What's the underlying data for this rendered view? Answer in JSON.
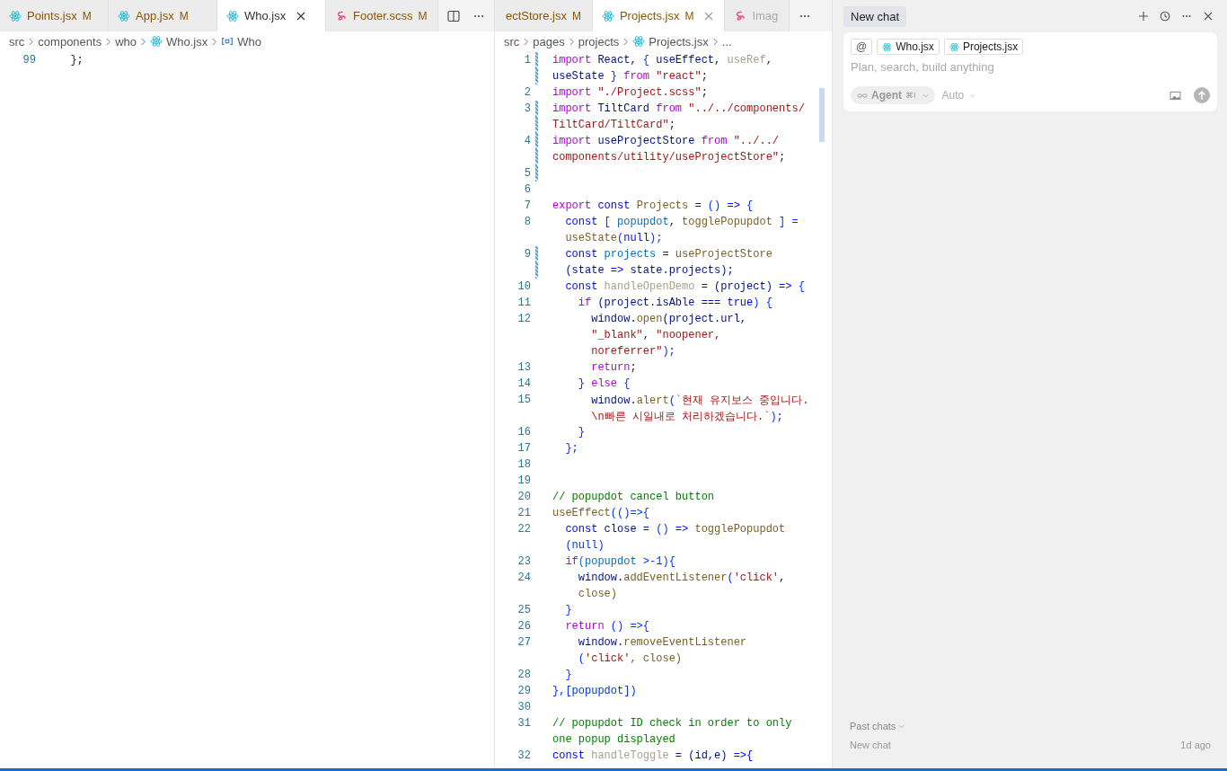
{
  "left_group": {
    "tabs": [
      {
        "label": "Points.jsx",
        "kind": "jsx",
        "status": "M",
        "selected": false,
        "faded": false
      },
      {
        "label": "App.jsx",
        "kind": "jsx",
        "status": "M",
        "selected": false,
        "faded": false
      },
      {
        "label": "Who.jsx",
        "kind": "jsx",
        "selected": true,
        "faded": false
      },
      {
        "label": "Footer.scss",
        "kind": "scss",
        "status": "M",
        "selected": false,
        "faded": false
      }
    ],
    "breadcrumb": [
      {
        "label": "src",
        "kind": "folder"
      },
      {
        "label": "components",
        "kind": "folder"
      },
      {
        "label": "who",
        "kind": "folder"
      },
      {
        "label": "Who.jsx",
        "kind": "jsx"
      },
      {
        "label": "Who",
        "kind": "symbol"
      }
    ],
    "lines": [
      {
        "number": "99",
        "modified": false,
        "rows": [
          {
            "segments": [
              {
                "text": "  };",
                "kind": "p"
              }
            ]
          }
        ]
      }
    ]
  },
  "right_group": {
    "tabs": [
      {
        "label": "ectStore.jsx",
        "kind": "plain",
        "status": "M",
        "selected": false,
        "faded": false
      },
      {
        "label": "Projects.jsx",
        "kind": "jsx",
        "status": "M",
        "selected": true,
        "faded": false
      },
      {
        "label": "Imag",
        "kind": "scss",
        "selected": false,
        "faded": true
      }
    ],
    "breadcrumb": [
      {
        "label": "src",
        "kind": "folder"
      },
      {
        "label": "pages",
        "kind": "folder"
      },
      {
        "label": "projects",
        "kind": "folder"
      },
      {
        "label": "Projects.jsx",
        "kind": "jsx"
      },
      {
        "label": "...",
        "kind": "folder"
      }
    ],
    "lines": [
      {
        "number": "1",
        "modified": true,
        "rows": [
          {
            "segments": [
              {
                "text": "import",
                "kind": "kw"
              },
              {
                "text": " React, ",
                "kind": "var"
              },
              {
                "text": "{",
                "kind": "br"
              },
              {
                "text": " useEffect, ",
                "kind": "var"
              },
              {
                "text": "useRef",
                "kind": "dim"
              },
              {
                "text": ",",
                "kind": "p"
              }
            ]
          },
          {
            "segments": [
              {
                "text": "useState ",
                "kind": "var"
              },
              {
                "text": "}",
                "kind": "br"
              },
              {
                "text": " from ",
                "kind": "kw"
              },
              {
                "text": "\"react\"",
                "kind": "str"
              },
              {
                "text": ";",
                "kind": "p"
              }
            ]
          }
        ]
      },
      {
        "number": "2",
        "modified": false,
        "rows": [
          {
            "segments": [
              {
                "text": "import ",
                "kind": "kw"
              },
              {
                "text": "\"./Project.scss\"",
                "kind": "str"
              },
              {
                "text": ";",
                "kind": "p"
              }
            ]
          }
        ]
      },
      {
        "number": "3",
        "modified": true,
        "rows": [
          {
            "segments": [
              {
                "text": "import",
                "kind": "kw"
              },
              {
                "text": " TiltCard ",
                "kind": "var"
              },
              {
                "text": "from",
                "kind": "kw"
              },
              {
                "text": " \"../../components/",
                "kind": "str"
              }
            ]
          },
          {
            "segments": [
              {
                "text": "TiltCard/TiltCard\"",
                "kind": "str"
              },
              {
                "text": ";",
                "kind": "p"
              }
            ]
          }
        ]
      },
      {
        "number": "4",
        "modified": true,
        "rows": [
          {
            "segments": [
              {
                "text": "import",
                "kind": "kw"
              },
              {
                "text": " useProjectStore ",
                "kind": "var"
              },
              {
                "text": "from",
                "kind": "kw"
              },
              {
                "text": " \"../../",
                "kind": "str"
              }
            ]
          },
          {
            "segments": [
              {
                "text": "components/utility/useProjectStore\"",
                "kind": "str"
              },
              {
                "text": ";",
                "kind": "p"
              }
            ]
          }
        ]
      },
      {
        "number": "5",
        "modified": true,
        "rows": [
          {
            "segments": []
          }
        ]
      },
      {
        "number": "6",
        "modified": false,
        "rows": [
          {
            "segments": []
          }
        ]
      },
      {
        "number": "7",
        "modified": false,
        "rows": [
          {
            "segments": [
              {
                "text": "export",
                "kind": "kw"
              },
              {
                "text": " const",
                "kind": "decl"
              },
              {
                "text": " Projects ",
                "kind": "fn"
              },
              {
                "text": "= ",
                "kind": "p"
              },
              {
                "text": "()",
                "kind": "br"
              },
              {
                "text": " => ",
                "kind": "decl"
              },
              {
                "text": "{",
                "kind": "br"
              }
            ]
          }
        ]
      },
      {
        "number": "8",
        "modified": false,
        "rows": [
          {
            "segments": [
              {
                "text": "  const",
                "kind": "decl"
              },
              {
                "text": " [ ",
                "kind": "br"
              },
              {
                "text": "popupdot",
                "kind": "var2"
              },
              {
                "text": ", ",
                "kind": "p"
              },
              {
                "text": "togglePopupdot",
                "kind": "fn"
              },
              {
                "text": " ] =",
                "kind": "br"
              }
            ]
          },
          {
            "segments": [
              {
                "text": "  useState",
                "kind": "fn"
              },
              {
                "text": "(",
                "kind": "br"
              },
              {
                "text": "null",
                "kind": "decl"
              },
              {
                "text": ");",
                "kind": "br"
              }
            ]
          }
        ]
      },
      {
        "number": "9",
        "modified": true,
        "rows": [
          {
            "segments": [
              {
                "text": "  const",
                "kind": "decl"
              },
              {
                "text": " projects ",
                "kind": "var2"
              },
              {
                "text": "= ",
                "kind": "p"
              },
              {
                "text": "useProjectStore",
                "kind": "fn"
              }
            ]
          },
          {
            "segments": [
              {
                "text": "  (state ",
                "kind": "var"
              },
              {
                "text": "=>",
                "kind": "decl"
              },
              {
                "text": " state.projects);",
                "kind": "var"
              }
            ]
          }
        ]
      },
      {
        "number": "10",
        "modified": false,
        "rows": [
          {
            "segments": [
              {
                "text": "  const",
                "kind": "decl"
              },
              {
                "text": " handleOpenDemo ",
                "kind": "dim"
              },
              {
                "text": "= ",
                "kind": "p"
              },
              {
                "text": "(project) ",
                "kind": "var"
              },
              {
                "text": "=>",
                "kind": "decl"
              },
              {
                "text": " {",
                "kind": "br"
              }
            ]
          }
        ]
      },
      {
        "number": "11",
        "modified": false,
        "rows": [
          {
            "segments": [
              {
                "text": "    if",
                "kind": "kw"
              },
              {
                "text": " (project.isAble === ",
                "kind": "var"
              },
              {
                "text": "true",
                "kind": "decl"
              },
              {
                "text": ") {",
                "kind": "br"
              }
            ]
          }
        ]
      },
      {
        "number": "12",
        "modified": false,
        "rows": [
          {
            "segments": [
              {
                "text": "      window.",
                "kind": "var"
              },
              {
                "text": "open",
                "kind": "fn"
              },
              {
                "text": "(project.url,",
                "kind": "var"
              }
            ]
          },
          {
            "segments": [
              {
                "text": "      \"_blank\"",
                "kind": "str"
              },
              {
                "text": ", ",
                "kind": "p"
              },
              {
                "text": "\"noopener,",
                "kind": "str"
              }
            ]
          },
          {
            "segments": [
              {
                "text": "      noreferrer\"",
                "kind": "str"
              },
              {
                "text": ");",
                "kind": "br"
              }
            ]
          }
        ]
      },
      {
        "number": "13",
        "modified": false,
        "rows": [
          {
            "segments": [
              {
                "text": "      return",
                "kind": "kw"
              },
              {
                "text": ";",
                "kind": "p"
              }
            ]
          }
        ]
      },
      {
        "number": "14",
        "modified": false,
        "rows": [
          {
            "segments": [
              {
                "text": "    } ",
                "kind": "br"
              },
              {
                "text": "else",
                "kind": "kw"
              },
              {
                "text": " {",
                "kind": "br"
              }
            ]
          }
        ]
      },
      {
        "number": "15",
        "modified": false,
        "rows": [
          {
            "segments": [
              {
                "text": "      window.",
                "kind": "var"
              },
              {
                "text": "alert",
                "kind": "fn"
              },
              {
                "text": "(",
                "kind": "br"
              },
              {
                "text": "`현재 유지보스 중입니다.",
                "kind": "str"
              }
            ]
          },
          {
            "segments": [
              {
                "text": "      \\n빠른 시일내로 처리하겠습니다.`",
                "kind": "str"
              },
              {
                "text": ");",
                "kind": "br"
              }
            ]
          }
        ]
      },
      {
        "number": "16",
        "modified": false,
        "rows": [
          {
            "segments": [
              {
                "text": "    }",
                "kind": "br"
              }
            ]
          }
        ]
      },
      {
        "number": "17",
        "modified": false,
        "rows": [
          {
            "segments": [
              {
                "text": "  };",
                "kind": "br"
              }
            ]
          }
        ]
      },
      {
        "number": "18",
        "modified": false,
        "rows": [
          {
            "segments": []
          }
        ]
      },
      {
        "number": "19",
        "modified": false,
        "rows": [
          {
            "segments": []
          }
        ]
      },
      {
        "number": "20",
        "modified": false,
        "rows": [
          {
            "segments": [
              {
                "text": "// popupdot cancel button",
                "kind": "com"
              }
            ]
          }
        ]
      },
      {
        "number": "21",
        "modified": false,
        "rows": [
          {
            "segments": [
              {
                "text": "useEffect",
                "kind": "fn"
              },
              {
                "text": "(()=>{",
                "kind": "br"
              }
            ]
          }
        ]
      },
      {
        "number": "22",
        "modified": false,
        "rows": [
          {
            "segments": [
              {
                "text": "  const",
                "kind": "decl"
              },
              {
                "text": " close = ",
                "kind": "var"
              },
              {
                "text": "()",
                "kind": "br"
              },
              {
                "text": " => ",
                "kind": "decl"
              },
              {
                "text": "togglePopupdot",
                "kind": "fn"
              }
            ]
          },
          {
            "segments": [
              {
                "text": "  (null)",
                "kind": "br"
              }
            ]
          }
        ]
      },
      {
        "number": "23",
        "modified": false,
        "rows": [
          {
            "segments": [
              {
                "text": "  if",
                "kind": "kw"
              },
              {
                "text": "(popupdot ",
                "kind": "var2"
              },
              {
                "text": ">-1){",
                "kind": "br"
              }
            ]
          }
        ]
      },
      {
        "number": "24",
        "modified": false,
        "rows": [
          {
            "segments": [
              {
                "text": "    window.",
                "kind": "var"
              },
              {
                "text": "addEventListener",
                "kind": "fn"
              },
              {
                "text": "(",
                "kind": "br"
              },
              {
                "text": "'click'",
                "kind": "str"
              },
              {
                "text": ",",
                "kind": "p"
              }
            ]
          },
          {
            "segments": [
              {
                "text": "    close)",
                "kind": "fn"
              }
            ]
          }
        ]
      },
      {
        "number": "25",
        "modified": false,
        "rows": [
          {
            "segments": [
              {
                "text": "  }",
                "kind": "br"
              }
            ]
          }
        ]
      },
      {
        "number": "26",
        "modified": false,
        "rows": [
          {
            "segments": [
              {
                "text": "  return",
                "kind": "kw"
              },
              {
                "text": " () =>{",
                "kind": "br"
              }
            ]
          }
        ]
      },
      {
        "number": "27",
        "modified": false,
        "rows": [
          {
            "segments": [
              {
                "text": "    window.",
                "kind": "var"
              },
              {
                "text": "removeEventListener",
                "kind": "fn"
              }
            ]
          },
          {
            "segments": [
              {
                "text": "    (",
                "kind": "br"
              },
              {
                "text": "'click'",
                "kind": "str"
              },
              {
                "text": ", close)",
                "kind": "fn"
              }
            ]
          }
        ]
      },
      {
        "number": "28",
        "modified": false,
        "rows": [
          {
            "segments": [
              {
                "text": "  }",
                "kind": "br"
              }
            ]
          }
        ]
      },
      {
        "number": "29",
        "modified": false,
        "rows": [
          {
            "segments": [
              {
                "text": "},[popupdot])",
                "kind": "br"
              }
            ]
          }
        ]
      },
      {
        "number": "30",
        "modified": false,
        "rows": [
          {
            "segments": []
          }
        ]
      },
      {
        "number": "31",
        "modified": false,
        "rows": [
          {
            "segments": [
              {
                "text": "// popupdot ID check in order to only",
                "kind": "com"
              }
            ]
          },
          {
            "segments": [
              {
                "text": "one popup displayed",
                "kind": "com"
              }
            ]
          }
        ]
      },
      {
        "number": "32",
        "modified": false,
        "rows": [
          {
            "segments": [
              {
                "text": "const",
                "kind": "decl"
              },
              {
                "text": " handleToggle ",
                "kind": "dim"
              },
              {
                "text": "= (id,e) ",
                "kind": "var"
              },
              {
                "text": "=>{",
                "kind": "decl"
              }
            ]
          }
        ]
      }
    ]
  },
  "chat": {
    "title": "New chat",
    "input": {
      "mention": "@",
      "chips": [
        "Who.jsx",
        "Projects.jsx"
      ],
      "placeholder": "Plan, search, build anything",
      "mode": "Agent",
      "shortcut": "⌘I",
      "model": "Auto"
    },
    "past_chats": {
      "title": "Past chats",
      "items": [
        {
          "title": "New chat",
          "time": "1d ago"
        }
      ]
    }
  }
}
